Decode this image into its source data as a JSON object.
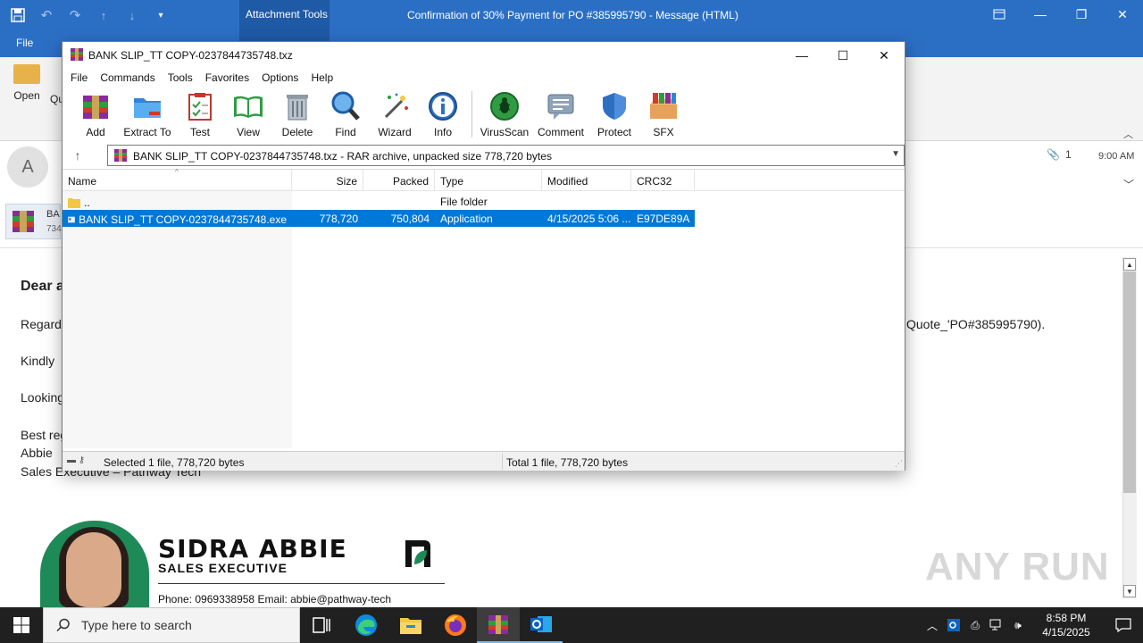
{
  "outlook": {
    "contextual_tab": "Attachment Tools",
    "window_title": "Confirmation of 30% Payment for PO #385995790  -  Message (HTML)",
    "file_tab": "File",
    "open_label": "Open",
    "qu_label": "Qu",
    "avatar_initial": "A",
    "attachment_count": "1",
    "received_time": "9:00 AM",
    "attachment_name": "BA",
    "attachment_size": "734",
    "body": {
      "greeting": "Dear a",
      "line1_start": "Regard",
      "line1_end": "Quote_'PO#385995790).",
      "line2": "Kindly",
      "line3": "Looking",
      "signoff": "Best reg",
      "name": "Abbie",
      "title": "Sales Executive – Pathway Tech"
    },
    "signature": {
      "name": "SIDRA ABBIE",
      "role": "SALES EXECUTIVE",
      "contact": "Phone: 0969338958   Email: abbie@pathway-tech"
    },
    "watermark": "ANY RUN"
  },
  "winrar": {
    "title": "BANK SLIP_TT COPY-0237844735748.txz",
    "menu": [
      "File",
      "Commands",
      "Tools",
      "Favorites",
      "Options",
      "Help"
    ],
    "toolbar": [
      {
        "label": "Add",
        "icon": "add-archive-icon"
      },
      {
        "label": "Extract To",
        "icon": "extract-folder-icon"
      },
      {
        "label": "Test",
        "icon": "test-clipboard-icon"
      },
      {
        "label": "View",
        "icon": "view-book-icon"
      },
      {
        "label": "Delete",
        "icon": "delete-trash-icon"
      },
      {
        "label": "Find",
        "icon": "find-magnifier-icon"
      },
      {
        "label": "Wizard",
        "icon": "wizard-wand-icon"
      },
      {
        "label": "Info",
        "icon": "info-icon"
      },
      {
        "label": "VirusScan",
        "icon": "virusscan-icon"
      },
      {
        "label": "Comment",
        "icon": "comment-icon"
      },
      {
        "label": "Protect",
        "icon": "protect-shield-icon"
      },
      {
        "label": "SFX",
        "icon": "sfx-box-icon"
      }
    ],
    "path": "BANK SLIP_TT COPY-0237844735748.txz - RAR archive, unpacked size 778,720 bytes",
    "columns": [
      "Name",
      "Size",
      "Packed",
      "Type",
      "Modified",
      "CRC32"
    ],
    "rows": [
      {
        "name": "..",
        "size": "",
        "packed": "",
        "type": "File folder",
        "modified": "",
        "crc": ""
      },
      {
        "name": "BANK SLIP_TT COPY-0237844735748.exe",
        "size": "778,720",
        "packed": "750,804",
        "type": "Application",
        "modified": "4/15/2025 5:06 ...",
        "crc": "E97DE89A"
      }
    ],
    "status_left": "Selected 1 file, 778,720 bytes",
    "status_right": "Total 1 file, 778,720 bytes"
  },
  "taskbar": {
    "search_placeholder": "Type here to search",
    "time": "8:58 PM",
    "date": "4/15/2025"
  },
  "colors": {
    "outlook_blue": "#2b6fc5",
    "selection_blue": "#0078d7",
    "taskbar": "#202020",
    "brand_green": "#1e8a57"
  }
}
